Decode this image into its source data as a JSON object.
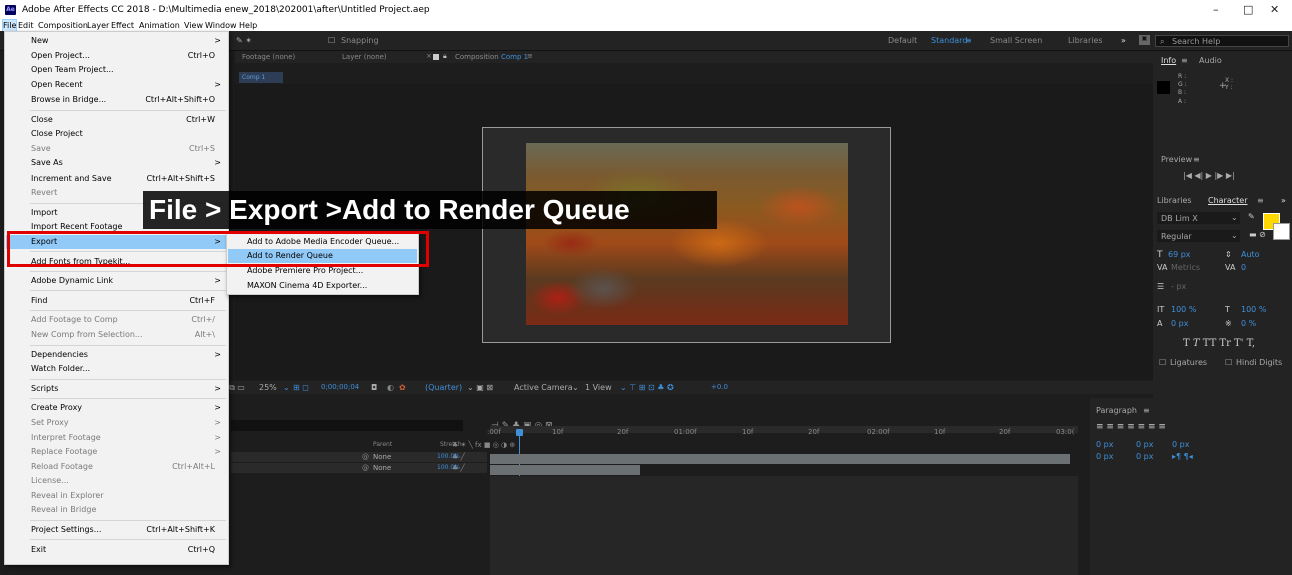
{
  "titlebar": {
    "app_icon": "Ae",
    "title": "Adobe After Effects CC 2018 - D:\\Multimedia enew_2018\\202001\\after\\Untitled Project.aep",
    "minimize": "–",
    "maximize": "□",
    "close": "✕"
  },
  "menubar": {
    "items": [
      "File",
      "Edit",
      "Composition",
      "Layer",
      "Effect",
      "Animation",
      "View",
      "Window",
      "Help"
    ]
  },
  "toolbar": {
    "snapping": "Snapping",
    "workspaces": [
      "Default",
      "Standard",
      "Small Screen",
      "Libraries"
    ],
    "more": "»",
    "search_placeholder": "Search Help"
  },
  "panels": {
    "footage": "Footage (none)",
    "layer": "Layer (none)",
    "composition": "Composition",
    "comp_name": "Comp 1",
    "comp_tab": "Comp 1"
  },
  "file_menu": {
    "items": [
      {
        "label": "New",
        "shortcut": "",
        "arrow": ">"
      },
      {
        "label": "Open Project...",
        "shortcut": "Ctrl+O"
      },
      {
        "label": "Open Team Project...",
        "shortcut": ""
      },
      {
        "label": "Open Recent",
        "shortcut": "",
        "arrow": ">"
      },
      {
        "label": "Browse in Bridge...",
        "shortcut": "Ctrl+Alt+Shift+O"
      },
      {
        "label": "Close",
        "shortcut": "Ctrl+W"
      },
      {
        "label": "Close Project",
        "shortcut": ""
      },
      {
        "label": "Save",
        "shortcut": "Ctrl+S",
        "disabled": true
      },
      {
        "label": "Save As",
        "shortcut": "",
        "arrow": ">"
      },
      {
        "label": "Increment and Save",
        "shortcut": "Ctrl+Alt+Shift+S"
      },
      {
        "label": "Revert",
        "shortcut": "",
        "disabled": true
      },
      {
        "label": "Import",
        "shortcut": ""
      },
      {
        "label": "Import Recent Footage",
        "shortcut": ""
      },
      {
        "label": "Export",
        "shortcut": "",
        "arrow": ">",
        "selected": true
      },
      {
        "label": "Add Fonts from Typekit...",
        "shortcut": ""
      },
      {
        "label": "Adobe Dynamic Link",
        "shortcut": "",
        "arrow": ">"
      },
      {
        "label": "Find",
        "shortcut": "Ctrl+F"
      },
      {
        "label": "Add Footage to Comp",
        "shortcut": "Ctrl+/",
        "disabled": true
      },
      {
        "label": "New Comp from Selection...",
        "shortcut": "Alt+\\",
        "disabled": true
      },
      {
        "label": "Dependencies",
        "shortcut": "",
        "arrow": ">"
      },
      {
        "label": "Watch Folder...",
        "shortcut": ""
      },
      {
        "label": "Scripts",
        "shortcut": "",
        "arrow": ">"
      },
      {
        "label": "Create Proxy",
        "shortcut": "",
        "arrow": ">"
      },
      {
        "label": "Set Proxy",
        "shortcut": "",
        "arrow": ">",
        "disabled": true
      },
      {
        "label": "Interpret Footage",
        "shortcut": "",
        "arrow": ">",
        "disabled": true
      },
      {
        "label": "Replace Footage",
        "shortcut": "",
        "arrow": ">",
        "disabled": true
      },
      {
        "label": "Reload Footage",
        "shortcut": "Ctrl+Alt+L",
        "disabled": true
      },
      {
        "label": "License...",
        "shortcut": "",
        "disabled": true
      },
      {
        "label": "Reveal in Explorer",
        "shortcut": "",
        "disabled": true
      },
      {
        "label": "Reveal in Bridge",
        "shortcut": "",
        "disabled": true
      },
      {
        "label": "Project Settings...",
        "shortcut": "Ctrl+Alt+Shift+K"
      },
      {
        "label": "Exit",
        "shortcut": "Ctrl+Q"
      }
    ]
  },
  "export_submenu": {
    "items": [
      "Add to Adobe Media Encoder Queue...",
      "Add to Render Queue",
      "Adobe Premiere Pro Project...",
      "MAXON Cinema 4D Exporter..."
    ]
  },
  "caption": "File > Export >Add to Render Queue",
  "viewer_bar": {
    "zoom": "25%",
    "timecode": "0;00;00;04",
    "resolution": "(Quarter)",
    "camera": "Active Camera",
    "view": "1 View",
    "exposure": "+0.0"
  },
  "timeline": {
    "ruler": [
      ":00f",
      "10f",
      "20f",
      "01:00f",
      "10f",
      "20f",
      "02:00f",
      "10f",
      "20f",
      "03:0("
    ],
    "parent_header": "Parent",
    "stretch_header": "Stretch",
    "rows": [
      {
        "parent": "None",
        "stretch": "100.0%"
      },
      {
        "parent": "None",
        "stretch": "100.0%"
      }
    ]
  },
  "info": {
    "tab": "Info",
    "audio": "Audio",
    "r": "R :",
    "g": "G :",
    "b": "B :",
    "a": "A :",
    "x": "X :",
    "y": "Y :"
  },
  "preview": {
    "tab": "Preview"
  },
  "character": {
    "libraries": "Libraries",
    "tab": "Character",
    "font": "DB Lim X",
    "style": "Regular",
    "size": "69 px",
    "leading": "Auto",
    "kerning": "Metrics",
    "tracking": "0",
    "stroke": "- px",
    "vscale": "100 %",
    "hscale": "100 %",
    "baseline": "0 px",
    "tsume": "0 %",
    "ligatures": "Ligatures",
    "hindi": "Hindi Digits",
    "fill_color": "#ffd800"
  },
  "paragraph": {
    "tab": "Paragraph",
    "vals": [
      "0 px",
      "0 px",
      "0 px",
      "0 px",
      "0 px"
    ]
  }
}
